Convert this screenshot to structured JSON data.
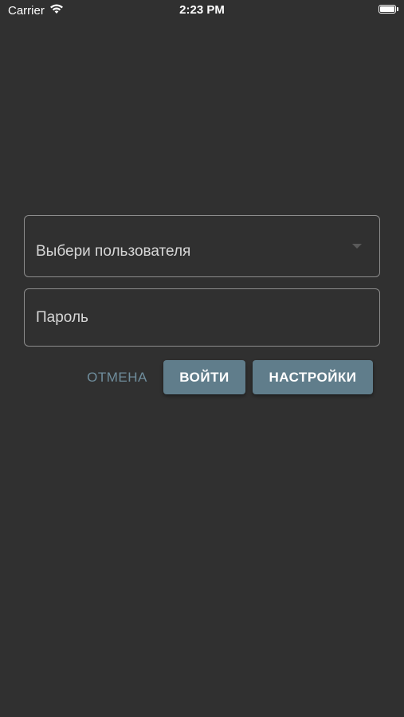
{
  "status_bar": {
    "carrier": "Carrier",
    "time": "2:23 PM"
  },
  "form": {
    "user_select_placeholder": "Выбери пользователя",
    "password_placeholder": "Пароль"
  },
  "actions": {
    "cancel_label": "ОТМЕНА",
    "login_label": "ВОЙТИ",
    "settings_label": "НАСТРОЙКИ"
  },
  "colors": {
    "background": "#303030",
    "accent": "#607d8b"
  },
  "icons": {
    "wifi": "wifi-icon",
    "battery": "battery-icon",
    "dropdown": "chevron-down-icon"
  }
}
